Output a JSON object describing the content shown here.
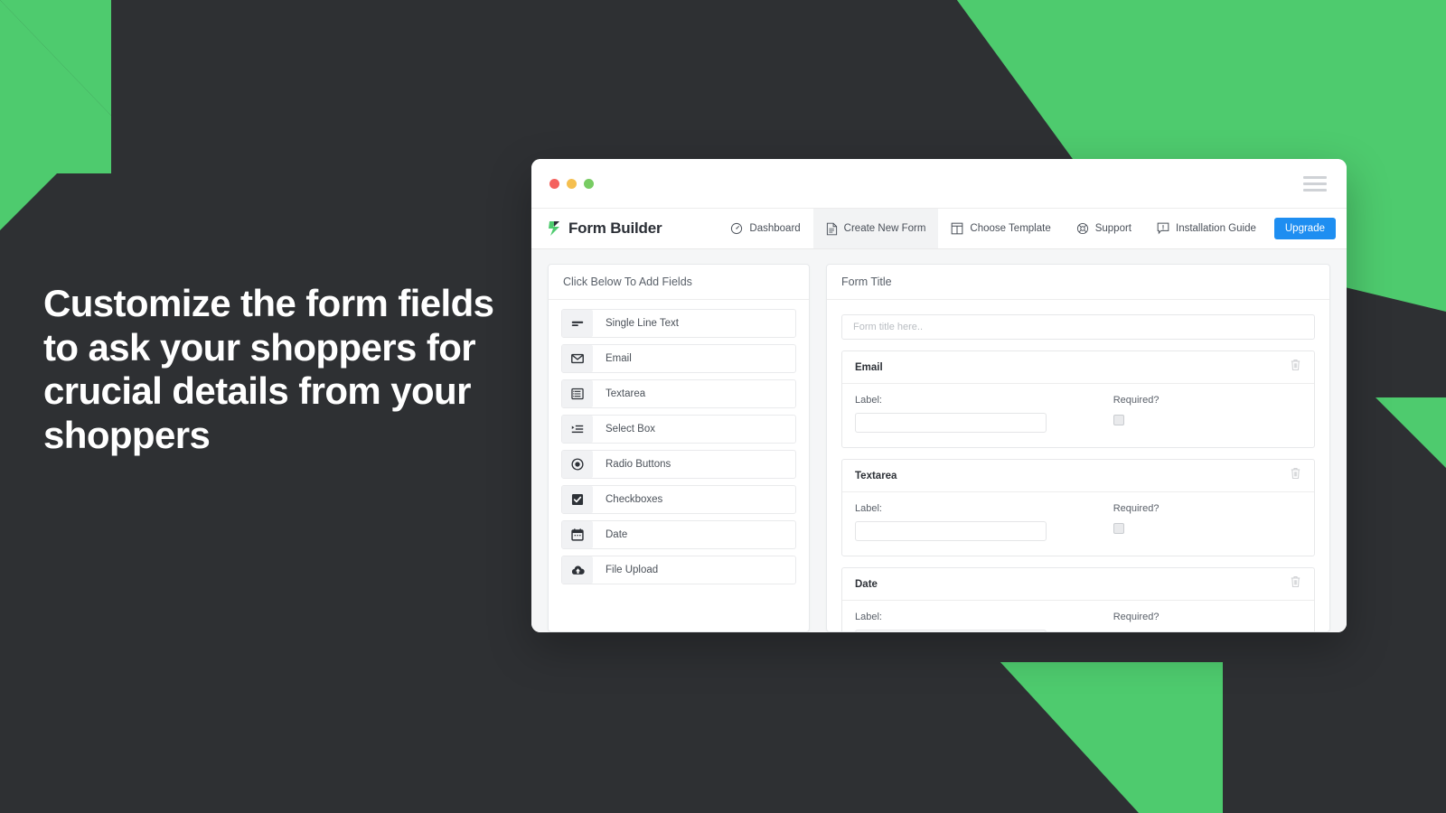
{
  "colors": {
    "background": "#2e3033",
    "accent_green": "#4ecb6e",
    "upgrade_blue": "#1e8ef1",
    "headline_text": "#ffffff"
  },
  "headline": {
    "text": "Customize the form fields to ask your shoppers for crucial details from your shoppers"
  },
  "window": {
    "traffic_lights": [
      "close",
      "minimize",
      "maximize"
    ],
    "menu_icon": "hamburger-icon",
    "brand": {
      "logo_icon": "green-arrow-logo-icon",
      "name": "Form Builder"
    },
    "nav_items": [
      {
        "label": "Dashboard",
        "icon": "speedometer-icon",
        "active": false
      },
      {
        "label": "Create New Form",
        "icon": "document-icon",
        "active": true
      },
      {
        "label": "Choose Template",
        "icon": "layout-icon",
        "active": false
      },
      {
        "label": "Support",
        "icon": "lifebuoy-icon",
        "active": false
      },
      {
        "label": "Installation Guide",
        "icon": "comment-alert-icon",
        "active": false
      }
    ],
    "upgrade_button": {
      "label": "Upgrade"
    }
  },
  "left_panel": {
    "header": "Click Below To Add Fields",
    "fields": [
      {
        "label": "Single Line Text",
        "icon": "single-line-text-icon"
      },
      {
        "label": "Email",
        "icon": "envelope-icon"
      },
      {
        "label": "Textarea",
        "icon": "textarea-icon"
      },
      {
        "label": "Select Box",
        "icon": "select-box-icon"
      },
      {
        "label": "Radio Buttons",
        "icon": "radio-button-icon"
      },
      {
        "label": "Checkboxes",
        "icon": "checkbox-icon"
      },
      {
        "label": "Date",
        "icon": "calendar-icon"
      },
      {
        "label": "File Upload",
        "icon": "cloud-upload-icon"
      }
    ]
  },
  "right_panel": {
    "header": "Form Title",
    "form_title_input": {
      "value": "",
      "placeholder": "Form title here.."
    },
    "field_cards": [
      {
        "title": "Email",
        "label_caption": "Label:",
        "label_value": "",
        "required_caption": "Required?",
        "required_checked": false,
        "delete_icon": "trash-icon"
      },
      {
        "title": "Textarea",
        "label_caption": "Label:",
        "label_value": "",
        "required_caption": "Required?",
        "required_checked": false,
        "delete_icon": "trash-icon"
      },
      {
        "title": "Date",
        "label_caption": "Label:",
        "label_value": "",
        "required_caption": "Required?",
        "required_checked": false,
        "delete_icon": "trash-icon"
      }
    ]
  }
}
